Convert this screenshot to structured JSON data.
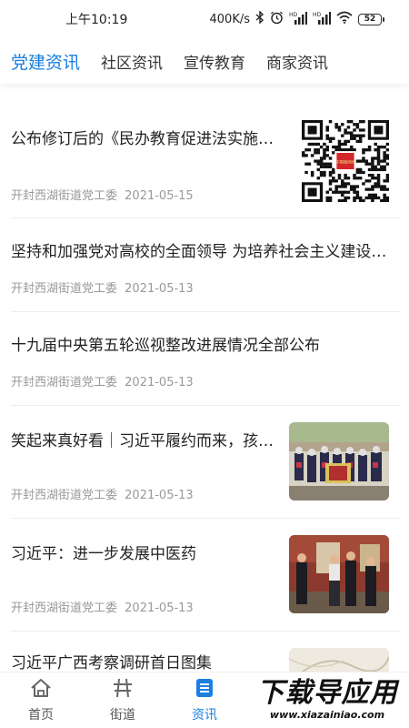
{
  "status_bar": {
    "time": "上午10:19",
    "speed": "400K/s",
    "signal_label_1": "HD",
    "signal_label_2": "HD",
    "battery": "52"
  },
  "tabs": [
    {
      "label": "党建资讯",
      "active": true
    },
    {
      "label": "社区资讯",
      "active": false
    },
    {
      "label": "宣传教育",
      "active": false
    },
    {
      "label": "商家资讯",
      "active": false
    }
  ],
  "news": [
    {
      "title": "公布修订后的《民办教育促进法实施条例》",
      "source": "开封西湖街道党工委",
      "date": "2021-05-15",
      "thumb": "qr-code",
      "qr_center": "中国政府网"
    },
    {
      "title": "坚持和加强党对高校的全面领导 为培养社会主义建设者和接班人",
      "source": "开封西湖街道党工委",
      "date": "2021-05-13",
      "thumb": ""
    },
    {
      "title": "十九届中央第五轮巡视整改进展情况全部公布",
      "source": "开封西湖街道党工委",
      "date": "2021-05-13",
      "thumb": ""
    },
    {
      "title": "笑起来真好看｜习近平履约而来，孩子们笑了",
      "source": "开封西湖街道党工委",
      "date": "2021-05-13",
      "thumb": "group-photo"
    },
    {
      "title": "习近平：进一步发展中医药",
      "source": "开封西湖街道党工委",
      "date": "2021-05-13",
      "thumb": "visit-photo"
    },
    {
      "title": "习近平广西考察调研首日图集",
      "source": "",
      "date": "",
      "thumb": "map-photo"
    }
  ],
  "bottom_nav": [
    {
      "label": "首页",
      "icon": "home-icon",
      "active": false
    },
    {
      "label": "街道",
      "icon": "street-icon",
      "active": false
    },
    {
      "label": "资讯",
      "icon": "news-icon",
      "active": true
    }
  ],
  "watermark": {
    "main": "下载导应用",
    "url": "www.xiazainiao.com"
  },
  "colors": {
    "accent": "#1a7fe0",
    "meta": "#999999"
  }
}
